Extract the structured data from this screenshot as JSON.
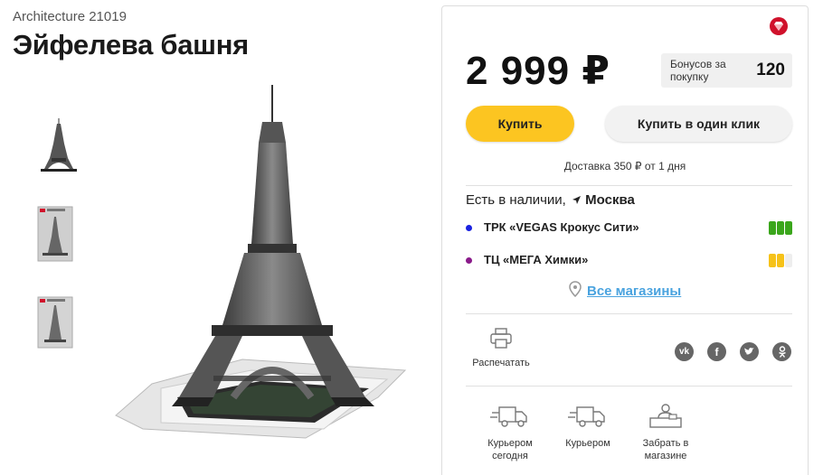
{
  "product": {
    "subtitle": "Architecture 21019",
    "title": "Эйфелева башня"
  },
  "thumbnails": [
    "tower-model-icon",
    "box-front-icon",
    "box-back-icon"
  ],
  "price": {
    "value": "2 999 ₽",
    "bonus_label": "Бонусов за покупку",
    "bonus_value": "120"
  },
  "actions": {
    "buy": "Купить",
    "one_click": "Купить в один клик"
  },
  "delivery": "Доставка 350 ₽ от 1 дня",
  "availability": {
    "label": "Есть в наличии,",
    "city": "Москва",
    "stores": [
      {
        "name": "ТРК «VEGAS Крокус Сити»",
        "dot_color": "#1a22e0",
        "levels": [
          "#3aa61b",
          "#3aa61b",
          "#3aa61b"
        ]
      },
      {
        "name": "ТЦ «МЕГА Химки»",
        "dot_color": "#8a1a8a",
        "levels": [
          "#f6c219",
          "#f6c219",
          "#eeeeee"
        ]
      }
    ],
    "all_stores": "Все магазины"
  },
  "tools": {
    "print": "Распечатать",
    "social": [
      "vk-icon",
      "facebook-icon",
      "twitter-icon",
      "odnoklassniki-icon"
    ]
  },
  "shipping": [
    {
      "label": "Курьером сегодня"
    },
    {
      "label": "Курьером"
    },
    {
      "label": "Забрать в магазине"
    }
  ],
  "colors": {
    "accent": "#fcc521",
    "link": "#4aa3df",
    "badge": "#d0112b"
  }
}
